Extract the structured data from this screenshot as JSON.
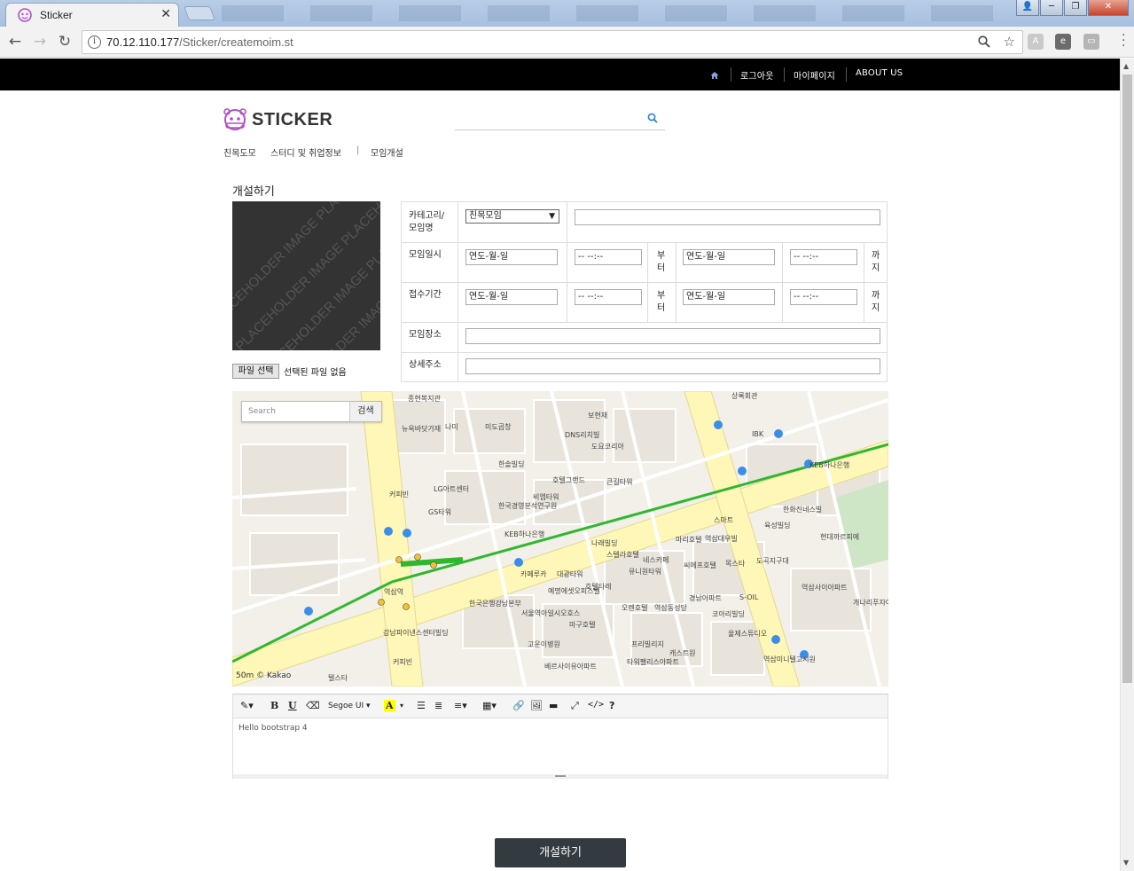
{
  "browser": {
    "tab_title": "Sticker",
    "url_host": "70.12.110.177",
    "url_path": "/Sticker/createmoim.st"
  },
  "site_nav": {
    "items": [
      "로그아웃",
      "마이페이지",
      "ABOUT US"
    ]
  },
  "header": {
    "brand": "STICKER"
  },
  "category_nav": {
    "items": [
      "친목도모",
      "스터디 및 취업정보",
      "|",
      "모임개설"
    ]
  },
  "form": {
    "page_title": "개설하기",
    "image_placeholder": "IMAGE PLACEHOLDER",
    "file_button": "파일 선택",
    "file_status": "선택된 파일 없음",
    "category_label_1": "카테고리/",
    "category_label_2": "모임명",
    "category_selected": "친목모임",
    "meeting_date_label": "모임일시",
    "period_label": "접수기간",
    "location_label": "모임장소",
    "address_label": "상세주소",
    "date_placeholder": "연도-월-일",
    "time_placeholder": "-- --:--",
    "from_1": "부",
    "from_2": "터",
    "until_1": "까",
    "until_2": "지"
  },
  "map": {
    "search_placeholder": "Search",
    "search_button": "검색",
    "scale": "50m",
    "attribution": "© Kakao",
    "labels": [
      "종현복지관",
      "상록회관",
      "뉴욕바닷가재",
      "나미",
      "미도곱창",
      "보현재",
      "DNS리치빌",
      "도요코리아",
      "IBK",
      "한솔빌딩",
      "호텔그랜드",
      "KEB하나은행",
      "LG아트센터",
      "커피빈",
      "GS타워",
      "한국경영분석연구원",
      "비엠타워",
      "큰길타워",
      "KEB하나은행",
      "나래빌딩",
      "스텔라호텔",
      "네스카페",
      "마리호텔",
      "역삼대우빌",
      "스마트",
      "육성빌딩",
      "도곡지구대",
      "카페루카",
      "대광타워",
      "유니원타워",
      "씨에프호텔",
      "목스타",
      "호텔타레",
      "예명에셋오피스텔",
      "한국은행강남본부",
      "서울역아일시오호스",
      "고운이병원",
      "마구호텔",
      "오렌호텔",
      "역삼동성당",
      "경남아파트",
      "코아리빌딩",
      "S-OIL",
      "역삼사이아파트",
      "개나리푸자아파트",
      "울제스튜디오",
      "캐스트원",
      "역삼미니텔고시원",
      "현대까르피에",
      "한화진네스빌",
      "강남파이낸스센터빌딩",
      "커피빈",
      "텔스타",
      "베르사이유아파트",
      "타워팰리스아파트",
      "프리빌리지",
      "역삼역"
    ]
  },
  "editor": {
    "font_name": "Segoe UI",
    "content": "Hello bootstrap 4"
  },
  "submit_button": "개설하기"
}
